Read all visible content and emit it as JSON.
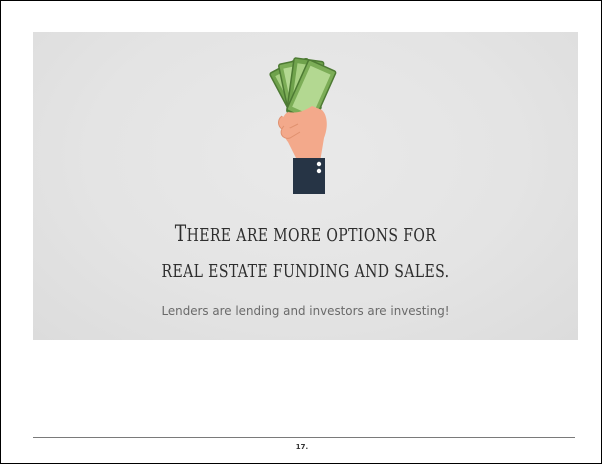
{
  "slide": {
    "headline_line1_first": "T",
    "headline_line1_rest": "HERE ARE MORE OPTIONS FOR",
    "headline_line2": "REAL ESTATE FUNDING AND SALES.",
    "subtitle": "Lenders are lending and investors are investing!",
    "illustration_icon": "hand-holding-cash-icon",
    "colors": {
      "background": "#e4e4e4",
      "cash_green": "#8fbf6b",
      "skin": "#f3a98b",
      "cuff": "#263445",
      "text": "#2d2d2d"
    }
  },
  "footer": {
    "page_number": "17."
  }
}
